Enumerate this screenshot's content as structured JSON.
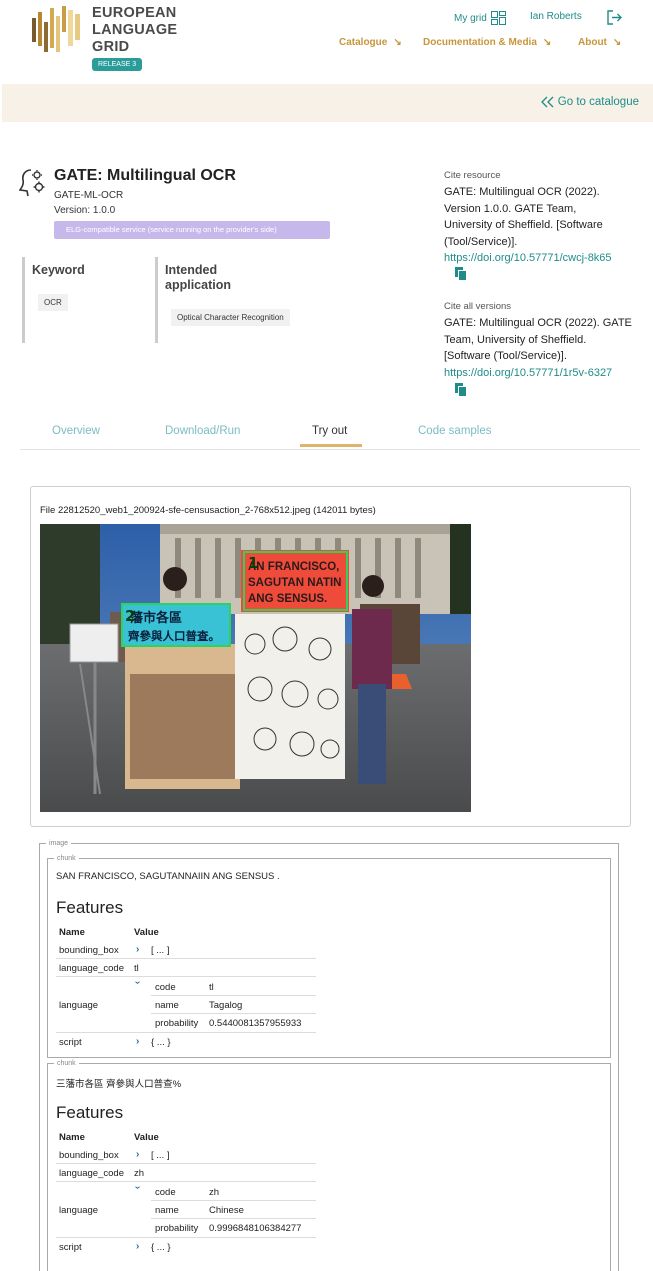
{
  "colors": {
    "teal": "#1f8c8a",
    "gold": "#c6973a",
    "badge_purple": "#c7b8eb",
    "tab_underline": "#e0b36a"
  },
  "header": {
    "logo_lines": [
      "EUROPEAN",
      "LANGUAGE",
      "GRID"
    ],
    "release": "RELEASE 3",
    "my_grid": "My grid",
    "user": "Ian Roberts",
    "nav": [
      "Catalogue",
      "Documentation & Media",
      "About"
    ]
  },
  "goto_catalogue": "Go to catalogue",
  "resource": {
    "title": "GATE: Multilingual OCR",
    "short_name": "GATE-ML-OCR",
    "version": "Version: 1.0.0",
    "elg_badge": "ELG-compatible service (service running on the provider's side)",
    "keyword_label": "Keyword",
    "keyword": "OCR",
    "intended_label_1": "Intended",
    "intended_label_2": "application",
    "intended": "Optical Character Recognition"
  },
  "cite": {
    "resource_label": "Cite resource",
    "resource_lines": [
      "GATE: Multilingual OCR (2022).",
      "Version 1.0.0. GATE Team,",
      "University of Sheffield. [Software",
      "(Tool/Service)]."
    ],
    "resource_doi": "https://doi.org/10.57771/cwcj-8k65",
    "all_label": "Cite all versions",
    "all_lines": [
      "GATE: Multilingual OCR (2022). GATE",
      "Team, University of Sheffield.",
      "[Software (Tool/Service)]."
    ],
    "all_doi": "https://doi.org/10.57771/1r5v-6327"
  },
  "tabs": [
    "Overview",
    "Download/Run",
    "Try out",
    "Code samples"
  ],
  "file": {
    "name": "File 22812520_web1_200924-sfe-censusaction_2-768x512.jpeg (142011 bytes)",
    "sign1_lines": [
      "AN FRANCISCO,",
      "SAGUTAN NATIN",
      "ANG SENSUS."
    ],
    "sign2_lines": [
      "藩市各區",
      "齊參與人口普查。"
    ],
    "box1_number": "1",
    "box2_number": "2"
  },
  "output": {
    "image_legend": "image",
    "chunk_legend": "chunk",
    "features_heading": "Features",
    "name_header": "Name",
    "value_header": "Value",
    "chunks": [
      {
        "text": "SAN FRANCISCO, SAGUTANNAIIN ANG SENSUS .",
        "bounding_box_label": "bounding_box",
        "bounding_box_value": "[ ... ]",
        "language_code_label": "language_code",
        "language_code_value": "tl",
        "language_label": "language",
        "code_label": "code",
        "code_value": "tl",
        "name_label": "name",
        "name_value": "Tagalog",
        "probability_label": "probability",
        "probability_value": "0.5440081357955933",
        "script_label": "script",
        "script_value": "{ ... }"
      },
      {
        "text": "三藩市各區 齊參與人口普查%",
        "bounding_box_label": "bounding_box",
        "bounding_box_value": "[ ... ]",
        "language_code_label": "language_code",
        "language_code_value": "zh",
        "language_label": "language",
        "code_label": "code",
        "code_value": "zh",
        "name_label": "name",
        "name_value": "Chinese",
        "probability_label": "probability",
        "probability_value": "0.9996848106384277",
        "script_label": "script",
        "script_value": "{ ... }"
      }
    ]
  }
}
